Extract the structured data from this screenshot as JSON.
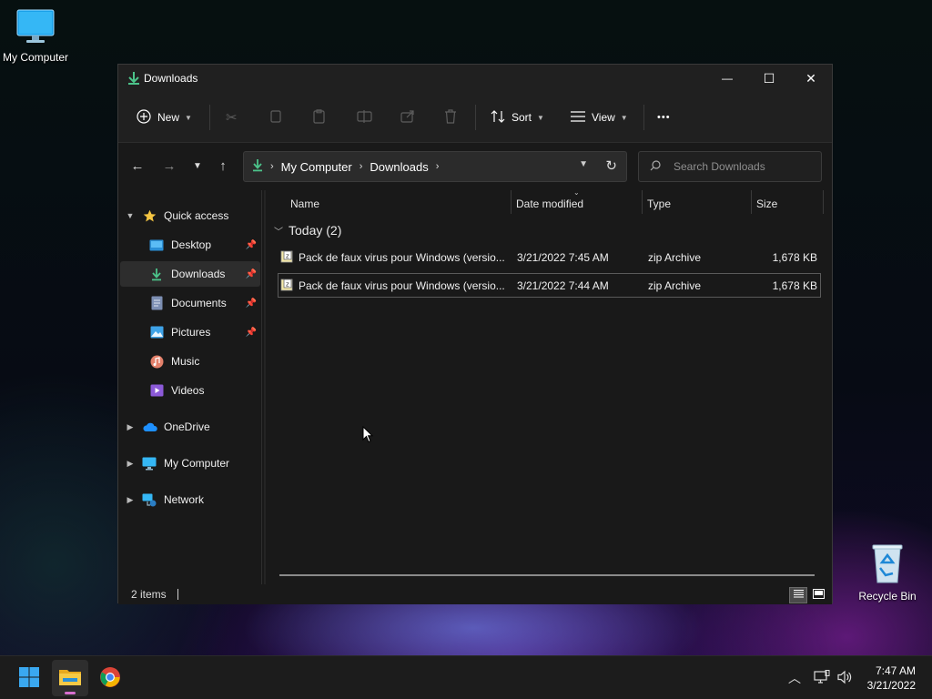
{
  "desktop": {
    "icons": [
      {
        "label": "My Computer",
        "icon": "monitor-icon"
      },
      {
        "label": "Recycle Bin",
        "icon": "recycle-bin-icon"
      }
    ]
  },
  "window": {
    "title": "Downloads",
    "controls": {
      "minimize": "—",
      "maximize": "☐",
      "close": "✕"
    }
  },
  "commandbar": {
    "new_label": "New",
    "sort_label": "Sort",
    "view_label": "View",
    "more_label": "•••",
    "disabled_actions": [
      "cut",
      "copy",
      "paste",
      "rename",
      "share",
      "delete"
    ]
  },
  "address": {
    "breadcrumbs": [
      "My Computer",
      "Downloads"
    ],
    "search_placeholder": "Search Downloads"
  },
  "navpane": {
    "quick_access": "Quick access",
    "pinned": [
      {
        "label": "Desktop",
        "pinned": true
      },
      {
        "label": "Downloads",
        "pinned": true,
        "selected": true
      },
      {
        "label": "Documents",
        "pinned": true
      },
      {
        "label": "Pictures",
        "pinned": true
      },
      {
        "label": "Music",
        "pinned": false
      },
      {
        "label": "Videos",
        "pinned": false
      }
    ],
    "roots": [
      "OneDrive",
      "My Computer",
      "Network"
    ]
  },
  "columns": {
    "name": "Name",
    "date": "Date modified",
    "type": "Type",
    "size": "Size"
  },
  "group": {
    "label": "Today (2)"
  },
  "files": [
    {
      "name": "Pack de faux virus pour Windows (versio...",
      "date": "3/21/2022 7:45 AM",
      "type": "zip Archive",
      "size": "1,678 KB"
    },
    {
      "name": "Pack de faux virus pour Windows (versio...",
      "date": "3/21/2022 7:44 AM",
      "type": "zip Archive",
      "size": "1,678 KB"
    }
  ],
  "status": {
    "count": "2 items"
  },
  "taskbar": {
    "apps": [
      "start-icon",
      "file-explorer-icon",
      "chrome-icon"
    ],
    "time": "7:47 AM",
    "date": "3/21/2022"
  },
  "colors": {
    "accent_green": "#4cc38a",
    "folder_yellow": "#f4c542",
    "selection": "#2d2d2d"
  }
}
